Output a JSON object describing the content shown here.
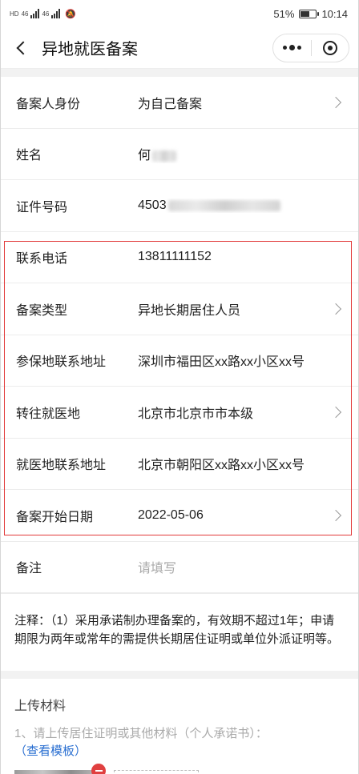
{
  "status_bar": {
    "left_labels": [
      "HD",
      "46",
      "46"
    ],
    "battery": "51%",
    "time": "10:14"
  },
  "nav": {
    "title": "异地就医备案"
  },
  "rows": [
    {
      "label": "备案人身份",
      "value": "为自己备案",
      "chevron": true
    },
    {
      "label": "姓名",
      "value": "何",
      "blurred": true
    },
    {
      "label": "证件号码",
      "value": "4503",
      "blurred": true
    },
    {
      "label": "联系电话",
      "value": "13811111152"
    },
    {
      "label": "备案类型",
      "value": "异地长期居住人员",
      "chevron": true
    },
    {
      "label": "参保地联系地址",
      "value": "深圳市福田区xx路xx小区xx号"
    },
    {
      "label": "转往就医地",
      "value": "北京市北京市市本级",
      "chevron": true
    },
    {
      "label": "就医地联系地址",
      "value": "北京市朝阳区xx路xx小区xx号"
    },
    {
      "label": "备案开始日期",
      "value": "2022-05-06",
      "chevron": true
    },
    {
      "label": "备注",
      "placeholder": "请填写"
    }
  ],
  "note": "注释：（1）采用承诺制办理备案的，有效期不超过1年；申请期限为两年或常年的需提供长期居住证明或单位外派证明等。",
  "upload": {
    "heading": "上传材料",
    "description": "1、请上传居住证明或其他材料（个人承诺书）：",
    "link": "（查看模板）"
  },
  "colors": {
    "highlight_border": "#e23a3a",
    "link": "#2a6fd1",
    "placeholder": "#aaaaaa"
  }
}
